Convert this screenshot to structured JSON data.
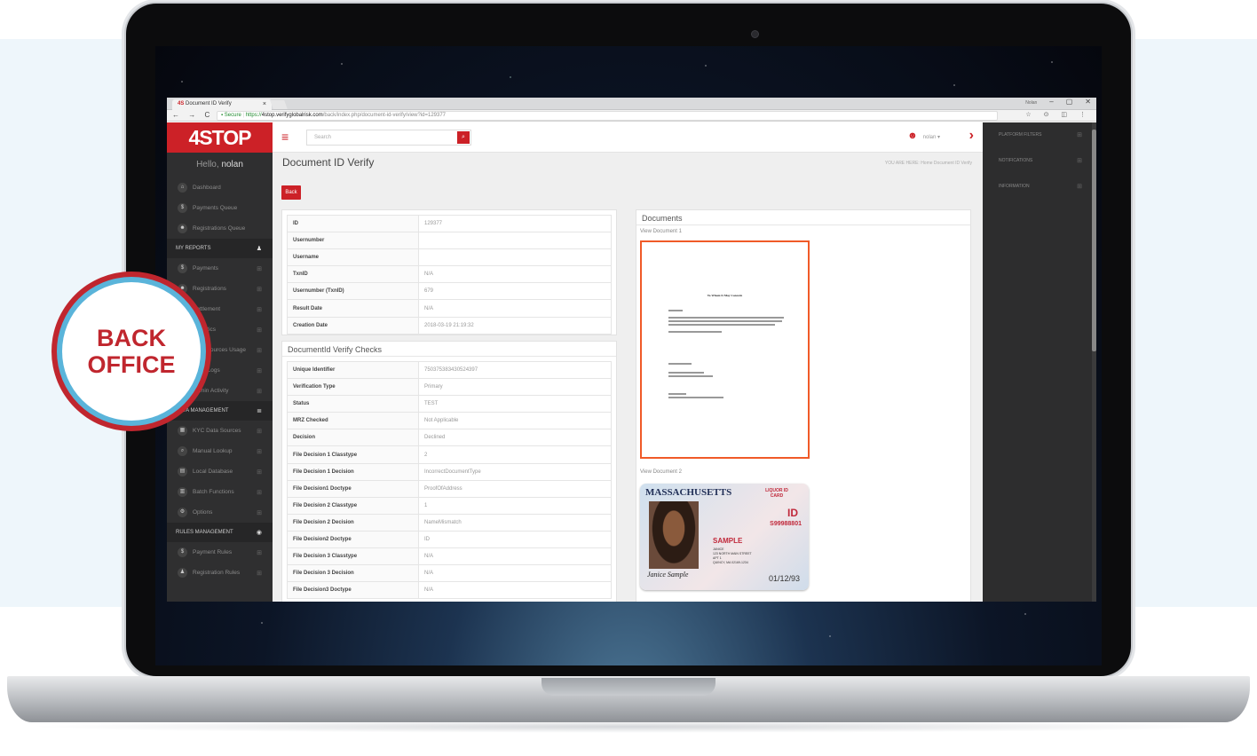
{
  "browser": {
    "tab_title": "Document ID Verify",
    "tab_logo": "4S",
    "tab_close": "×",
    "window_user": "Nolan",
    "window_controls": [
      "–",
      "▢",
      "✕"
    ],
    "nav_buttons": "← → C ⌂",
    "url_secure": "Secure",
    "url_scheme": "https://",
    "url_host": "4stop.verifyglobalrisk.com",
    "url_path": "/back/index.php/document-id-verify/view?id=129377",
    "extensions": "☆ ⊙ ◫ ⋮"
  },
  "sidebar": {
    "logo": "4STOP",
    "hello": "Hello,",
    "user": "nolan",
    "items": [
      {
        "label": "Dashboard",
        "icon": "home-icon",
        "glyph": "⌂"
      },
      {
        "label": "Payments Queue",
        "icon": "coin-icon",
        "glyph": "$"
      },
      {
        "label": "Registrations Queue",
        "icon": "user-icon",
        "glyph": "☻"
      }
    ],
    "sections": [
      {
        "label": "MY REPORTS",
        "glyph": "♟"
      },
      {
        "label": "DATA MANAGEMENT",
        "glyph": "≣"
      },
      {
        "label": "RULES MANAGEMENT",
        "glyph": "◉"
      }
    ],
    "reports": [
      {
        "label": "Payments",
        "glyph": "$"
      },
      {
        "label": "Registrations",
        "glyph": "☻"
      },
      {
        "label": "Settlement",
        "glyph": "≡"
      },
      {
        "label": "Analytics",
        "glyph": "▤"
      },
      {
        "label": "Data Sources Usage",
        "glyph": "◧"
      },
      {
        "label": "Audit Logs",
        "glyph": "✎"
      },
      {
        "label": "Admin Activity",
        "glyph": "◎"
      }
    ],
    "data_mgmt": [
      {
        "label": "KYC Data Sources",
        "glyph": "▦"
      },
      {
        "label": "Manual Lookup",
        "glyph": "⌕"
      },
      {
        "label": "Local Database",
        "glyph": "▤"
      },
      {
        "label": "Batch Functions",
        "glyph": "▥"
      },
      {
        "label": "Options",
        "glyph": "⚙"
      }
    ],
    "rules": [
      {
        "label": "Payment Rules",
        "glyph": "$"
      },
      {
        "label": "Registration Rules",
        "glyph": "♟"
      }
    ],
    "item_arrow": "⊞"
  },
  "topbar": {
    "menu_glyph": "≡",
    "search_placeholder": "Search",
    "search_glyph": "⌕",
    "user_glyph": "☻",
    "user_label": "nolan ▾",
    "arrow_glyph": "›"
  },
  "page": {
    "title": "Document ID Verify",
    "breadcrumb": "YOU ARE HERE:  Home  Document ID Verify",
    "back_label": "Back"
  },
  "summary": [
    {
      "k": "ID",
      "v": "129377"
    },
    {
      "k": "Usernumber",
      "v": ""
    },
    {
      "k": "Username",
      "v": ""
    },
    {
      "k": "TxnID",
      "v": "N/A"
    },
    {
      "k": "Usernumber (TxnID)",
      "v": "679"
    },
    {
      "k": "Result Date",
      "v": "N/A"
    },
    {
      "k": "Creation Date",
      "v": "2018-03-19 21:19:32"
    }
  ],
  "checks_title": "DocumentId Verify Checks",
  "checks": [
    {
      "k": "Unique Identifier",
      "v": "750375383430524397"
    },
    {
      "k": "Verification Type",
      "v": "Primary"
    },
    {
      "k": "Status",
      "v": "TEST"
    },
    {
      "k": "MRZ Checked",
      "v": "Not Applicable"
    },
    {
      "k": "Decision",
      "v": "Declined"
    },
    {
      "k": "File Decision 1 Classtype",
      "v": "2"
    },
    {
      "k": "File Decision 1 Decision",
      "v": "IncorrectDocumentType"
    },
    {
      "k": "File Decision1 Doctype",
      "v": "ProofOfAddress"
    },
    {
      "k": "File Decision 2 Classtype",
      "v": "1"
    },
    {
      "k": "File Decision 2 Decision",
      "v": "NameMismatch"
    },
    {
      "k": "File Decision2 Doctype",
      "v": "ID"
    },
    {
      "k": "File Decision 3 Classtype",
      "v": "N/A"
    },
    {
      "k": "File Decision 3 Decision",
      "v": "N/A"
    },
    {
      "k": "File Decision3 Doctype",
      "v": "N/A"
    }
  ],
  "documents": {
    "title": "Documents",
    "view1": "View Document 1",
    "view2": "View Document 2",
    "letter_title": "To Whom It May Concern",
    "license_state": "MASSACHUSETTS",
    "license_type": "LIQUOR ID CARD",
    "license_id": "ID",
    "license_number": "S99988801",
    "license_sample": "SAMPLE",
    "license_address": "JANICE\n123 NORTH MAIN STREET\nAPT 1\nQUINCY, MA 02169-1234",
    "license_signature": "Janice Sample",
    "license_dob": "01/12/93"
  },
  "right_panel": [
    {
      "label": "PLATFORM FILTERS"
    },
    {
      "label": "NOTIFICATIONS"
    },
    {
      "label": "INFORMATION"
    }
  ],
  "right_panel_glyph": "⊞",
  "badge": {
    "line1": "BACK",
    "line2": "OFFICE"
  },
  "colors": {
    "brand": "#cc2127",
    "badge_ring": "#5ab4da",
    "doc_border": "#f05a28"
  }
}
